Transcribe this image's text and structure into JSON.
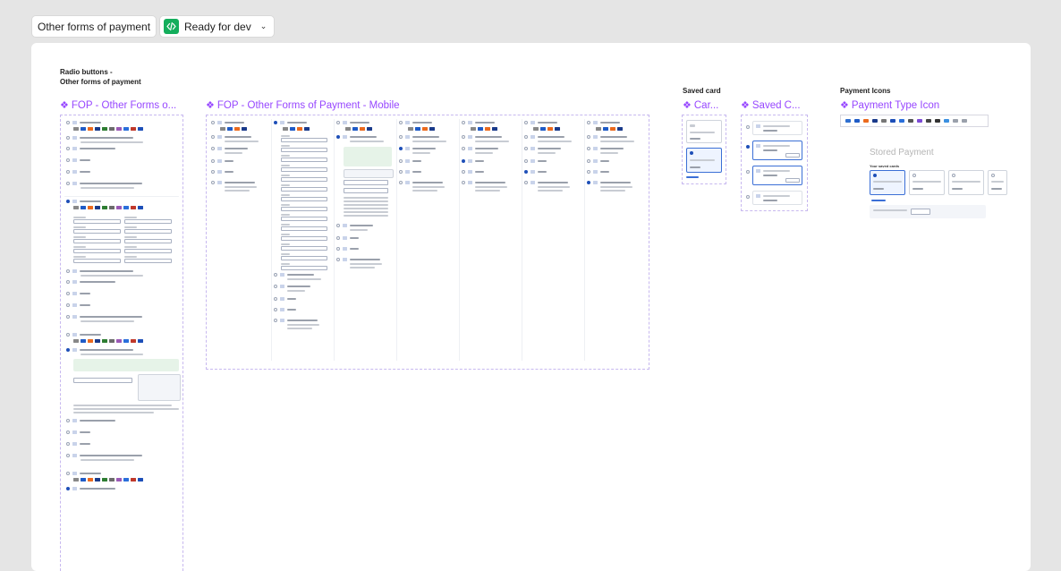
{
  "topbar": {
    "page_title": "Other forms of payment",
    "status": "Ready for dev",
    "status_color": "#14ae5c"
  },
  "accent_color": "#9747ff",
  "sections": {
    "radio_label": "Radio buttons -\nOther forms of payment",
    "saved_card_label": "Saved card",
    "payment_icons_label": "Payment Icons"
  },
  "components": {
    "fop_desktop": "FOP - Other Forms o...",
    "fop_mobile": "FOP - Other Forms of Payment - Mobile",
    "card": "Car...",
    "saved_card": "Saved C...",
    "payment_type_icon": "Payment Type Icon"
  },
  "stored_payment": {
    "title": "Stored Payment",
    "subtitle": "Your saved cards"
  }
}
